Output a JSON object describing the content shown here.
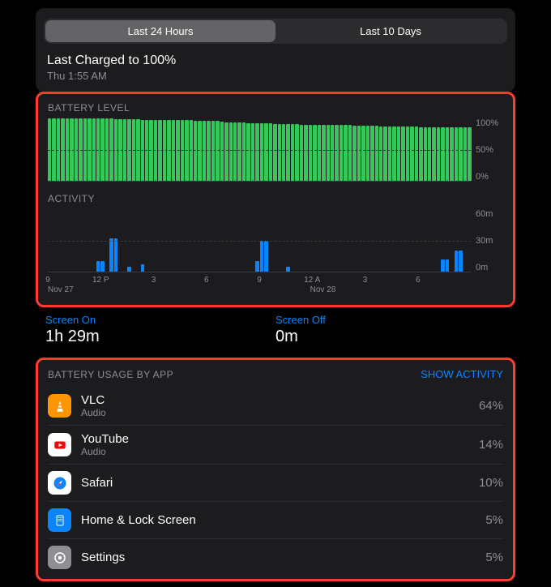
{
  "tabs": {
    "t24h": "Last 24 Hours",
    "t10d": "Last 10 Days",
    "active": "t24h"
  },
  "charged": {
    "title": "Last Charged to 100%",
    "sub": "Thu 1:55 AM"
  },
  "battery_section_label": "BATTERY LEVEL",
  "activity_section_label": "ACTIVITY",
  "y_battery": {
    "top": "100%",
    "mid": "50%",
    "bot": "0%"
  },
  "y_activity": {
    "top": "60m",
    "mid": "30m",
    "bot": "0m"
  },
  "x_ticks": [
    "9",
    "12 P",
    "3",
    "6",
    "9",
    "12 A",
    "3",
    "6"
  ],
  "x_dates": {
    "d1": "Nov 27",
    "d2": "Nov 28"
  },
  "screen_on": {
    "label": "Screen On",
    "value": "1h 29m"
  },
  "screen_off": {
    "label": "Screen Off",
    "value": "0m"
  },
  "usage_header": "BATTERY USAGE BY APP",
  "show_activity": "SHOW ACTIVITY",
  "apps": [
    {
      "name": "VLC",
      "sub": "Audio",
      "pct": "64%",
      "icon_bg": "#ff9500",
      "icon_fg": "#fff"
    },
    {
      "name": "YouTube",
      "sub": "Audio",
      "pct": "14%",
      "icon_bg": "#ffffff",
      "icon_fg": "#ff0000"
    },
    {
      "name": "Safari",
      "sub": "",
      "pct": "10%",
      "icon_bg": "#ffffff",
      "icon_fg": "#0a84ff"
    },
    {
      "name": "Home & Lock Screen",
      "sub": "",
      "pct": "5%",
      "icon_bg": "#0a84ff",
      "icon_fg": "#fff"
    },
    {
      "name": "Settings",
      "sub": "",
      "pct": "5%",
      "icon_bg": "#8e8e93",
      "icon_fg": "#fff"
    }
  ],
  "chart_data": {
    "battery": {
      "type": "bar",
      "title": "BATTERY LEVEL",
      "ylabel": "%",
      "ylim": [
        0,
        100
      ],
      "x_start": "Nov 27 09:00",
      "x_end": "Nov 28 09:00",
      "values": [
        100,
        100,
        100,
        100,
        100,
        100,
        100,
        100,
        100,
        100,
        100,
        100,
        100,
        100,
        100,
        99,
        99,
        99,
        99,
        99,
        99,
        98,
        98,
        98,
        98,
        98,
        98,
        97,
        97,
        97,
        97,
        97,
        97,
        96,
        96,
        96,
        96,
        96,
        96,
        95,
        94,
        93,
        93,
        93,
        93,
        92,
        92,
        92,
        92,
        92,
        92,
        91,
        91,
        91,
        91,
        91,
        91,
        90,
        90,
        90,
        90,
        90,
        90,
        89,
        89,
        89,
        89,
        89,
        89,
        88,
        88,
        88,
        88,
        88,
        88,
        87,
        87,
        87,
        87,
        87,
        87,
        87,
        87,
        87,
        86,
        86,
        86,
        86,
        86,
        86,
        86,
        86,
        86,
        86,
        86,
        86
      ]
    },
    "activity": {
      "type": "bar",
      "title": "ACTIVITY",
      "ylabel": "minutes",
      "ylim": [
        0,
        60
      ],
      "x_start": "Nov 27 09:00",
      "x_end": "Nov 28 09:00",
      "values": [
        0,
        0,
        0,
        0,
        0,
        0,
        0,
        0,
        0,
        0,
        0,
        10,
        10,
        0,
        32,
        32,
        0,
        0,
        5,
        0,
        0,
        7,
        0,
        0,
        0,
        0,
        0,
        0,
        0,
        0,
        0,
        0,
        0,
        0,
        0,
        0,
        0,
        0,
        0,
        0,
        0,
        0,
        0,
        0,
        0,
        0,
        0,
        10,
        30,
        30,
        0,
        0,
        0,
        0,
        5,
        0,
        0,
        0,
        0,
        0,
        0,
        0,
        0,
        0,
        0,
        0,
        0,
        0,
        0,
        0,
        0,
        0,
        0,
        0,
        0,
        0,
        0,
        0,
        0,
        0,
        0,
        0,
        0,
        0,
        0,
        0,
        0,
        0,
        0,
        12,
        12,
        0,
        20,
        20,
        0,
        0
      ]
    }
  }
}
